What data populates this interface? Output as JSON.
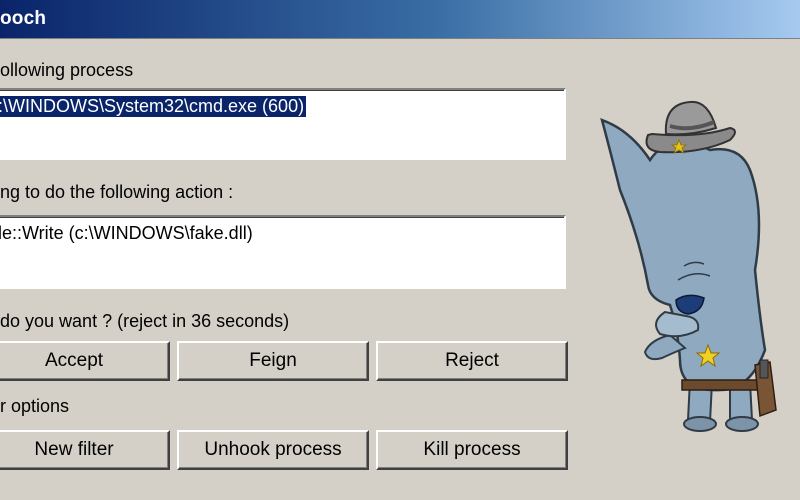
{
  "window": {
    "title": "ooch"
  },
  "process_section": {
    "label": "ollowing process",
    "value": ":\\WINDOWS\\System32\\cmd.exe (600)"
  },
  "action_section": {
    "label": "ng to do the following action :",
    "value": "le::Write (c:\\WINDOWS\\fake.dll)"
  },
  "question": {
    "label": "do you want ? (reject in 36 seconds)"
  },
  "action_buttons": {
    "accept": "Accept",
    "feign": "Feign",
    "reject": "Reject"
  },
  "options_section": {
    "label": "r options"
  },
  "option_buttons": {
    "new_filter": "New filter",
    "unhook_process": "Unhook process",
    "kill_process": "Kill process"
  },
  "colors": {
    "titlebar_start": "#0a246a",
    "titlebar_end": "#a6caf0",
    "window_bg": "#d4d0c8",
    "selection": "#0a246a",
    "mascot_skin": "#8fa9c0"
  },
  "icons": {
    "mascot": "cowboy-sheriff-mascot"
  }
}
